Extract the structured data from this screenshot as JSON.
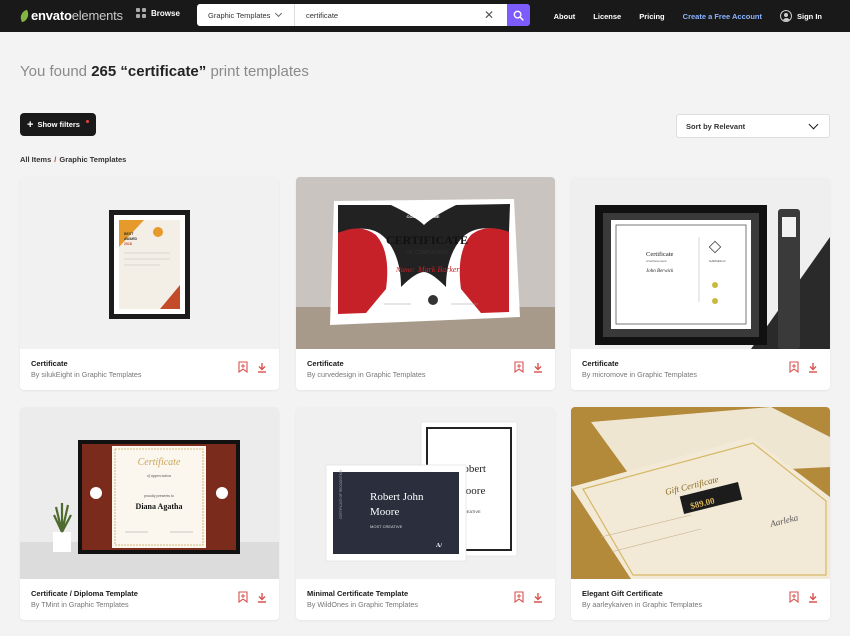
{
  "header": {
    "logo_main": "envato",
    "logo_sub": "elements",
    "browse_label": "Browse",
    "category_select": "Graphic Templates",
    "search_value": "certificate",
    "search_placeholder": "Search",
    "nav": [
      "About",
      "License",
      "Pricing"
    ],
    "create_account": "Create a Free Account",
    "sign_in": "Sign In",
    "accent_color": "#7c5cff"
  },
  "results": {
    "prefix": "You found",
    "count": "265",
    "query": "“certificate”",
    "suffix": "print templates"
  },
  "filters": {
    "show_filters": "Show filters",
    "sort_label": "Sort by Relevant"
  },
  "breadcrumb": {
    "root": "All Items",
    "sep": "/",
    "current": "Graphic Templates"
  },
  "cards": [
    {
      "title": "Certificate",
      "subtitle": "By silukEight in Graphic Templates",
      "thumb_text": [
        "BEST",
        "AWARD",
        "2018"
      ]
    },
    {
      "title": "Certificate",
      "subtitle": "By curvedesign in Graphic Templates",
      "thumb_text": [
        "COMPANY NAME",
        "CERTIFICATE",
        "OF COMPLETION",
        "Name:",
        "Mark Barker"
      ]
    },
    {
      "title": "Certificate",
      "subtitle": "By micromove in Graphic Templates",
      "thumb_text": [
        "Certificate",
        "of Achievement",
        "John Berwick",
        "GARGELLO"
      ]
    },
    {
      "title": "Certificate / Diploma Template",
      "subtitle": "By TMint in Graphic Templates",
      "thumb_text": [
        "Certificate",
        "of appreciation",
        "proudly presents to",
        "Diana Agatha"
      ]
    },
    {
      "title": "Minimal Certificate Template",
      "subtitle": "By WildOnes in Graphic Templates",
      "thumb_text": [
        "Robert John",
        "Moore",
        "MOST CREATIVE",
        "CERTIFICATE OF RECOGNITION",
        "Robert",
        "Moore",
        "CREATIVE"
      ]
    },
    {
      "title": "Elegant Gift Certificate",
      "subtitle": "By aarleykaiven in Graphic Templates",
      "thumb_text": [
        "Gift Certificate",
        "$89.00",
        "Aarleka"
      ]
    }
  ]
}
